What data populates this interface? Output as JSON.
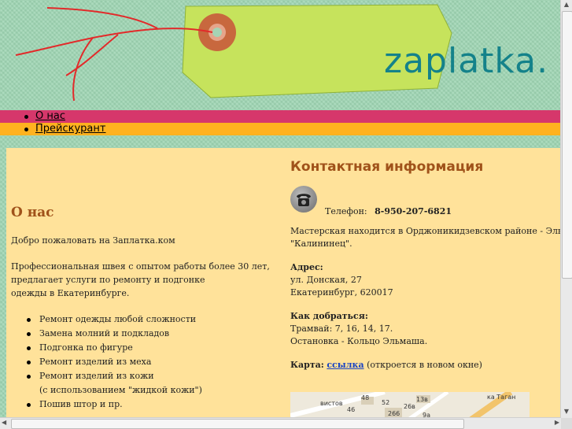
{
  "header": {
    "logo_text": "zaplatka."
  },
  "nav": [
    {
      "label": "О нас"
    },
    {
      "label": "Прейскурант"
    }
  ],
  "about": {
    "heading": "О нас",
    "welcome": "Добро пожаловать на Заплатка.ком",
    "intro_line1": "Профессиональная швея с опытом работы более 30 лет,",
    "intro_line2": "предлагает услуги по ремонту и подгонке",
    "intro_line3": "одежды в Екатеринбурге.",
    "services": [
      "Ремонт одежды любой сложности",
      "Замена молний и подкладов",
      "Подгонка по фигуре",
      "Ремонт изделий из меха",
      "Ремонт изделий из кожи",
      "(с использованием \"жидкой кожи\")",
      "Пошив штор и пр."
    ]
  },
  "contact": {
    "heading": "Контактная информация",
    "phone_label": "Телефон:",
    "phone_value": "8-950-207-6821",
    "location_line1": "Мастерская находится в Орджоникидзевском районе - Эльмаш, недалеко от",
    "location_line2": "\"Калининец\".",
    "address_label": "Адрес:",
    "address_line1": "ул. Донская, 27",
    "address_line2": "Екатеринбург, 620017",
    "directions_label": "Как добраться:",
    "directions_line1": "Трамвай: 7, 16, 14, 17.",
    "directions_line2": "Остановка - Кольцо Эльмаша.",
    "map_label": "Карта:",
    "map_link": "ссылка",
    "map_note": "(откроется в новом окне)"
  },
  "map": {
    "labels": [
      "48",
      "52",
      "13в",
      "26в",
      "46",
      "266",
      "9а",
      "вистов",
      "ка Таган"
    ]
  },
  "scrollbar": {
    "up_arrow": "▲",
    "down_arrow": "▼",
    "left_arrow": "◀",
    "right_arrow": "▶"
  }
}
